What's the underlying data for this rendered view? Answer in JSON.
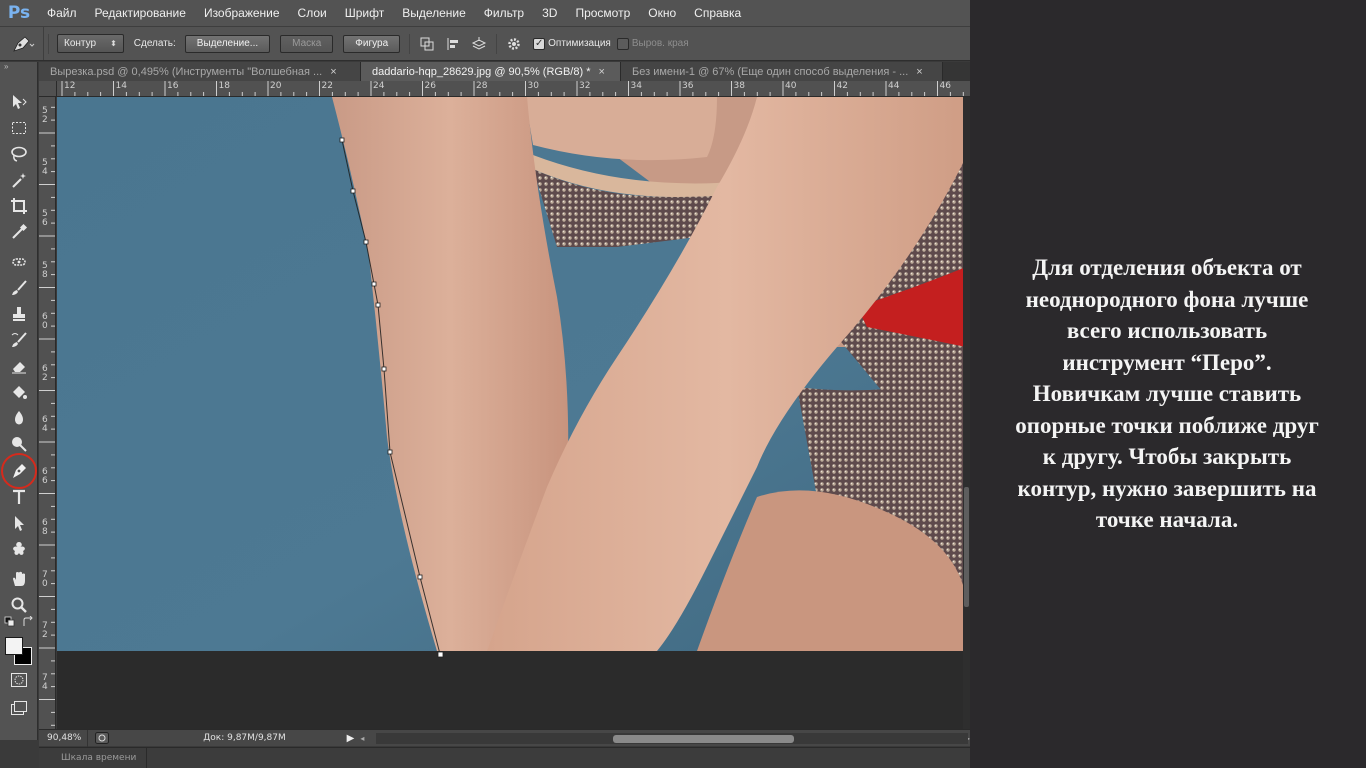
{
  "app": {
    "logo": "Ps"
  },
  "menu": [
    "Файл",
    "Редактирование",
    "Изображение",
    "Слои",
    "Шрифт",
    "Выделение",
    "Фильтр",
    "3D",
    "Просмотр",
    "Окно",
    "Справка"
  ],
  "options": {
    "mode": "Контур",
    "make_label": "Сделать:",
    "selection_btn": "Выделение...",
    "mask_btn": "Маска",
    "shape_btn": "Фигура",
    "autoadd_label": "Оптимизация",
    "align_edges_label": "Выров. края"
  },
  "tabs": [
    {
      "label": "Вырезка.psd @ 0,495% (Инструменты  \"Волшебная ...",
      "close": "×",
      "active": false
    },
    {
      "label": "daddario-hqp_28629.jpg @ 90,5% (RGB/8) *",
      "close": "×",
      "active": true
    },
    {
      "label": "Без имени-1 @ 67% (Еще один способ выделения - ...",
      "close": "×",
      "active": false
    }
  ],
  "ruler": {
    "h_labels": [
      "12",
      "14",
      "16",
      "18",
      "20",
      "22",
      "24",
      "26",
      "28",
      "30",
      "32",
      "34",
      "36",
      "38",
      "40",
      "42",
      "44",
      "46"
    ],
    "v_labels": [
      "5 2",
      "5 4",
      "5 6",
      "5 8",
      "6 0",
      "6 2",
      "6 4",
      "6 6",
      "6 8",
      "7 0",
      "7 2",
      "7 4"
    ]
  },
  "status": {
    "zoom": "90,48%",
    "doc": "Док: 9,87M/9,87M"
  },
  "timeline": {
    "label": "Шкала времени"
  },
  "caption": {
    "lines": [
      "Для отделения объекта от",
      "неоднородного фона лучше",
      "всего использовать",
      "инструмент “Перо”.",
      "Новичкам лучше ставить",
      "опорные точки поближе друг",
      "к другу. Чтобы закрыть",
      "контур, нужно завершить на",
      "точке начала."
    ]
  },
  "colors": {
    "background_blue": "#4d7a94",
    "skin": "#d4a48c",
    "highlight_circle": "#d62a1c",
    "ui_panel": "#535353"
  }
}
